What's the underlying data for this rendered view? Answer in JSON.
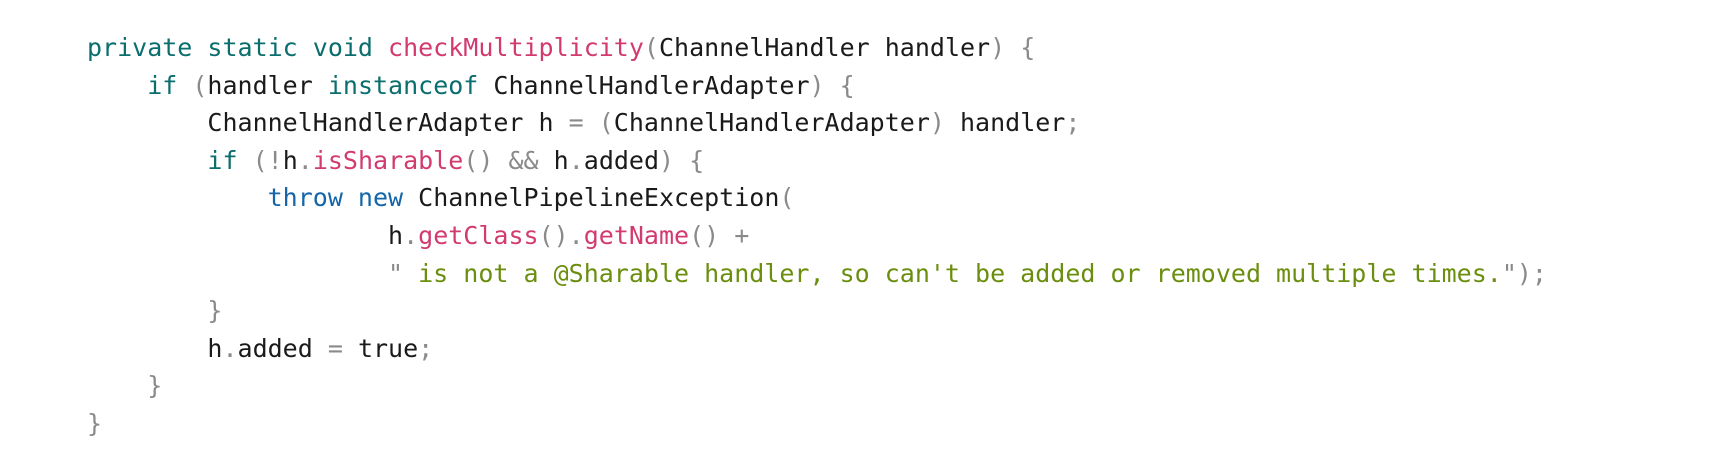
{
  "lines": [
    {
      "tokens": [
        {
          "t": "private static void ",
          "c": "keyword"
        },
        {
          "t": "checkMultiplicity",
          "c": "func"
        },
        {
          "t": "(",
          "c": "punct"
        },
        {
          "t": "ChannelHandler handler",
          "c": "ident"
        },
        {
          "t": ") {",
          "c": "punct"
        }
      ]
    },
    {
      "tokens": [
        {
          "t": "    if ",
          "c": "keyword"
        },
        {
          "t": "(",
          "c": "punct"
        },
        {
          "t": "handler ",
          "c": "ident"
        },
        {
          "t": "instanceof ",
          "c": "keyword"
        },
        {
          "t": "ChannelHandlerAdapter",
          "c": "ident"
        },
        {
          "t": ") {",
          "c": "punct"
        }
      ]
    },
    {
      "tokens": [
        {
          "t": "        ChannelHandlerAdapter h ",
          "c": "ident"
        },
        {
          "t": "= (",
          "c": "punct"
        },
        {
          "t": "ChannelHandlerAdapter",
          "c": "ident"
        },
        {
          "t": ") ",
          "c": "punct"
        },
        {
          "t": "handler",
          "c": "ident"
        },
        {
          "t": ";",
          "c": "punct"
        }
      ]
    },
    {
      "tokens": [
        {
          "t": "        if ",
          "c": "keyword"
        },
        {
          "t": "(!",
          "c": "punct"
        },
        {
          "t": "h",
          "c": "ident"
        },
        {
          "t": ".",
          "c": "punct"
        },
        {
          "t": "isSharable",
          "c": "func"
        },
        {
          "t": "() && ",
          "c": "punct"
        },
        {
          "t": "h",
          "c": "ident"
        },
        {
          "t": ".",
          "c": "punct"
        },
        {
          "t": "added",
          "c": "ident"
        },
        {
          "t": ") {",
          "c": "punct"
        }
      ]
    },
    {
      "tokens": [
        {
          "t": "            throw new ",
          "c": "kw-blue"
        },
        {
          "t": "ChannelPipelineException",
          "c": "ident"
        },
        {
          "t": "(",
          "c": "punct"
        }
      ]
    },
    {
      "tokens": [
        {
          "t": "                    h",
          "c": "ident"
        },
        {
          "t": ".",
          "c": "punct"
        },
        {
          "t": "getClass",
          "c": "func"
        },
        {
          "t": "().",
          "c": "punct"
        },
        {
          "t": "getName",
          "c": "func"
        },
        {
          "t": "() +",
          "c": "punct"
        }
      ]
    },
    {
      "tokens": [
        {
          "t": "                    \"",
          "c": "punct"
        },
        {
          "t": " is not a @Sharable handler, so can't be added or removed multiple times.",
          "c": "string"
        },
        {
          "t": "\");",
          "c": "punct"
        }
      ]
    },
    {
      "tokens": [
        {
          "t": "        }",
          "c": "punct"
        }
      ]
    },
    {
      "tokens": [
        {
          "t": "        h",
          "c": "ident"
        },
        {
          "t": ".",
          "c": "punct"
        },
        {
          "t": "added ",
          "c": "ident"
        },
        {
          "t": "= ",
          "c": "punct"
        },
        {
          "t": "true",
          "c": "ident"
        },
        {
          "t": ";",
          "c": "punct"
        }
      ]
    },
    {
      "tokens": [
        {
          "t": "    }",
          "c": "punct"
        }
      ]
    },
    {
      "tokens": [
        {
          "t": "}",
          "c": "punct"
        }
      ]
    }
  ],
  "colors": {
    "keyword": "#0b6e6e",
    "kw-blue": "#1565a8",
    "func": "#d23a70",
    "string": "#6b8e0f",
    "punct": "#8a8a8a",
    "ident": "#1a1a1a",
    "background": "#ffffff"
  }
}
